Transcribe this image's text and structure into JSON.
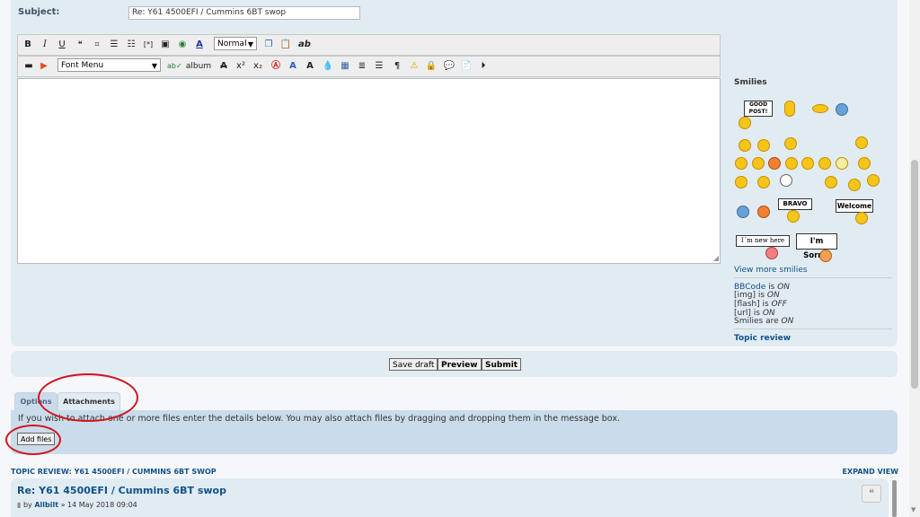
{
  "subject": {
    "label": "Subject:",
    "value": "Re: Y61 4500EFI / Cummins 6BT swop"
  },
  "toolbar": {
    "bold": "B",
    "italic": "I",
    "underline": "U",
    "font_size": "Normal",
    "font_menu": "Font Menu",
    "album": "album",
    "superscript": "x²",
    "subscript": "x₂",
    "ab": "ab"
  },
  "smilies": {
    "title": "Smilies",
    "signs": {
      "good_post_line1": "GOOD",
      "good_post_line2": "POST!",
      "bravo": "BRAVO",
      "welcome": "Welcome",
      "new_here": "I´m new here",
      "sorry": "I'm Sorry!"
    },
    "view_more": "View more smilies"
  },
  "status": {
    "bbcode_label": "BBCode",
    "bbcode_is": " is ",
    "bbcode_value": "ON",
    "img_label": "[img] is ",
    "img_value": "ON",
    "flash_label": "[flash] is ",
    "flash_value": "OFF",
    "url_label": "[url] is ",
    "url_value": "ON",
    "smilies_label": "Smilies are ",
    "smilies_value": "ON"
  },
  "topic_review_link": "Topic review",
  "buttons": {
    "save_draft": "Save draft",
    "preview": "Preview",
    "submit": "Submit"
  },
  "tabs": {
    "options": "Options",
    "attachments": "Attachments"
  },
  "attachments": {
    "instructions": "If you wish to attach one or more files enter the details below. You may also attach files by dragging and dropping them in the message box.",
    "add_files": "Add files"
  },
  "topic_review": {
    "heading": "TOPIC REVIEW: Y61 4500EFI / CUMMINS 6BT SWOP",
    "expand": "EXPAND VIEW",
    "post_title": "Re: Y61 4500EFI / Cummins 6BT swop",
    "by": "by ",
    "author": "Allbilt",
    "date": " » 14 May 2018 09:04"
  },
  "colors": {
    "panel": "#e1ebf2",
    "link": "#105289",
    "annotation_ring": "#d2141c"
  }
}
